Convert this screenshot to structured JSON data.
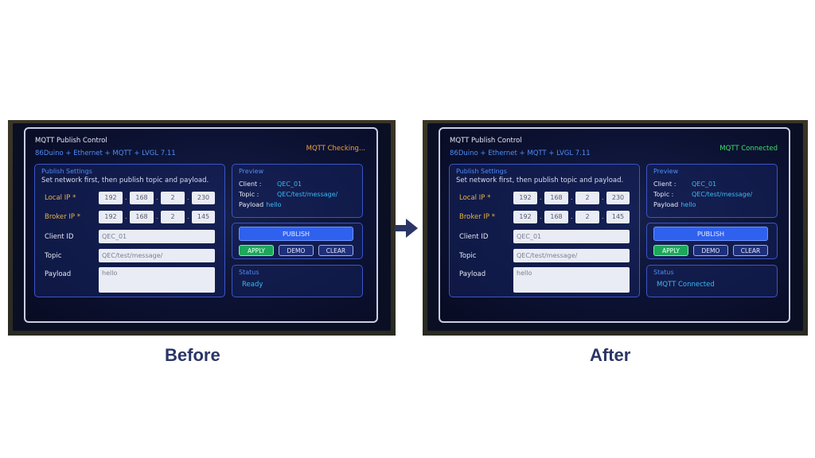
{
  "captions": {
    "before": "Before",
    "after": "After"
  },
  "colors": {
    "checking": "#f0a23a",
    "connected": "#3fe06a",
    "accent": "#2f61ef",
    "required": "#e7b343"
  },
  "before": {
    "title": "MQTT Publish Control",
    "subtitle": "86Duino + Ethernet + MQTT + LVGL 7.11",
    "conn_status": "MQTT Checking...",
    "publish_settings": {
      "title": "Publish Settings",
      "hint": "Set network first, then publish topic and payload.",
      "local_ip_label": "Local IP *",
      "local_ip": [
        "192",
        "168",
        "2",
        "230"
      ],
      "broker_ip_label": "Broker IP *",
      "broker_ip": [
        "192",
        "168",
        "2",
        "145"
      ],
      "client_id_label": "Client ID",
      "client_id": "QEC_01",
      "topic_label": "Topic",
      "topic": "QEC/test/message/",
      "payload_label": "Payload",
      "payload": "hello"
    },
    "preview": {
      "title": "Preview",
      "client_label": "Client :",
      "client": "QEC_01",
      "topic_label": "Topic :",
      "topic": "QEC/test/message/",
      "payload_label": "Payload",
      "payload": "hello"
    },
    "actions": {
      "publish": "PUBLISH",
      "apply": "APPLY",
      "demo": "DEMO",
      "clear": "CLEAR"
    },
    "status": {
      "title": "Status",
      "value": "Ready"
    }
  },
  "after": {
    "title": "MQTT Publish Control",
    "subtitle": "86Duino + Ethernet + MQTT + LVGL 7.11",
    "conn_status": "MQTT Connected",
    "publish_settings": {
      "title": "Publish Settings",
      "hint": "Set network first, then publish topic and payload.",
      "local_ip_label": "Local IP *",
      "local_ip": [
        "192",
        "168",
        "2",
        "230"
      ],
      "broker_ip_label": "Broker IP *",
      "broker_ip": [
        "192",
        "168",
        "2",
        "145"
      ],
      "client_id_label": "Client ID",
      "client_id": "QEC_01",
      "topic_label": "Topic",
      "topic": "QEC/test/message/",
      "payload_label": "Payload",
      "payload": "hello"
    },
    "preview": {
      "title": "Preview",
      "client_label": "Client :",
      "client": "QEC_01",
      "topic_label": "Topic :",
      "topic": "QEC/test/message/",
      "payload_label": "Payload",
      "payload": "hello"
    },
    "actions": {
      "publish": "PUBLISH",
      "apply": "APPLY",
      "demo": "DEMO",
      "clear": "CLEAR"
    },
    "status": {
      "title": "Status",
      "value": "MQTT Connected"
    }
  }
}
